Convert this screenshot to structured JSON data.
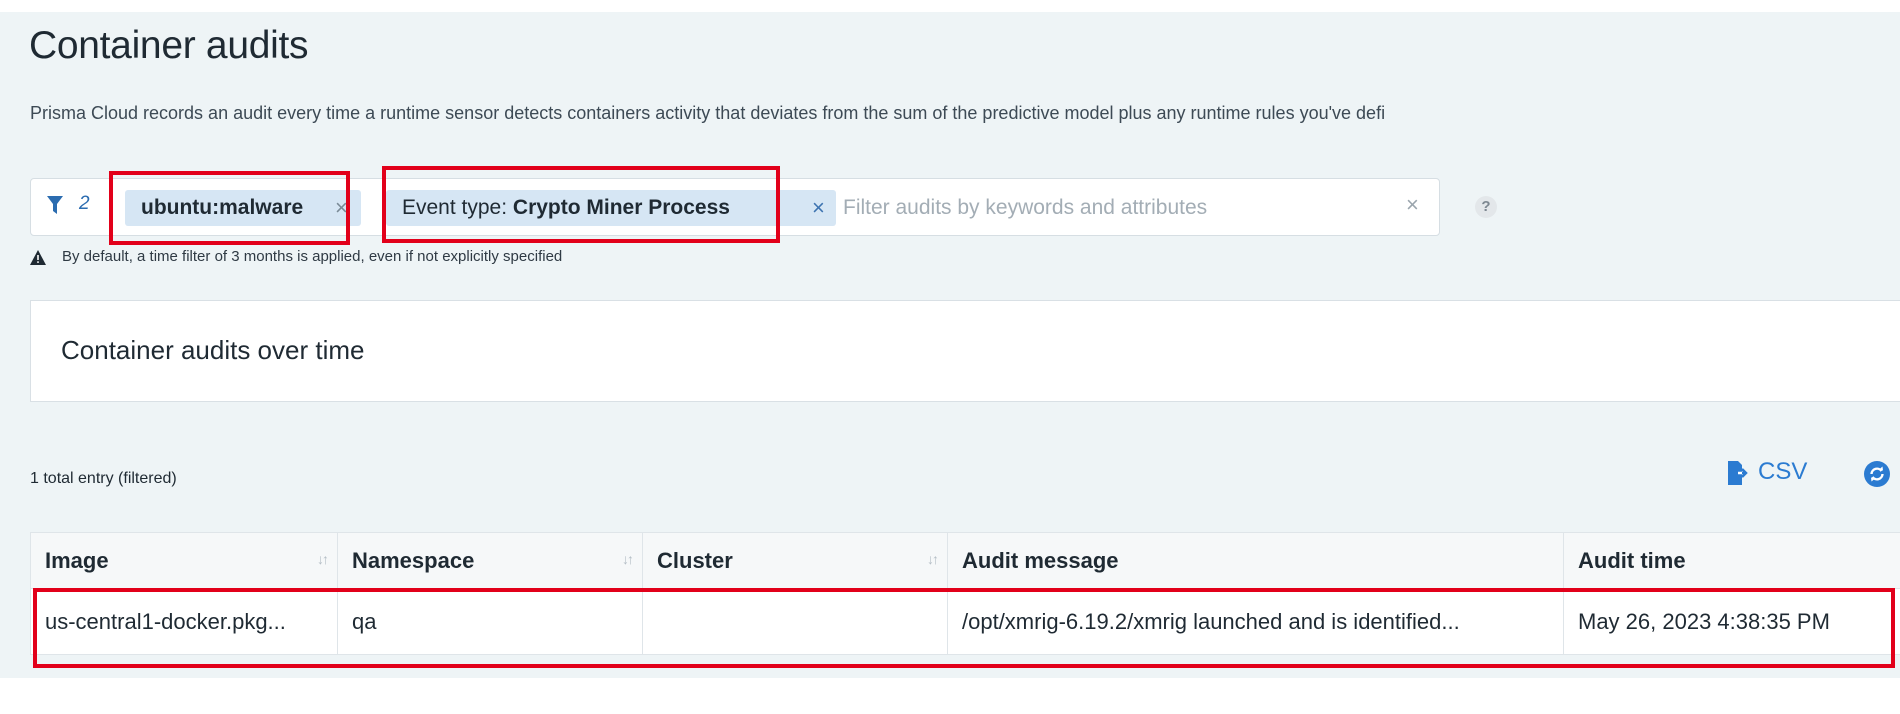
{
  "page": {
    "title": "Container audits",
    "description": "Prisma Cloud records an audit every time a runtime sensor detects containers activity that deviates from the sum of the predictive model plus any runtime rules you've defi"
  },
  "filter": {
    "count": "2",
    "chips": [
      {
        "text": "ubuntu:malware",
        "remove": "×"
      },
      {
        "prefix": "Event type: ",
        "value": "Crypto Miner Process",
        "remove": "×"
      }
    ],
    "search_placeholder": "Filter audits by keywords and attributes",
    "clear": "×",
    "help": "?",
    "note": "By default, a time filter of 3 months is applied, even if not explicitly specified"
  },
  "chart_card": {
    "title": "Container audits over time"
  },
  "table_toolbar": {
    "entry_count": "1 total entry (filtered)",
    "csv_label": "CSV"
  },
  "table": {
    "columns": [
      "Image",
      "Namespace",
      "Cluster",
      "Audit message",
      "Audit time"
    ],
    "rows": [
      [
        "us-central1-docker.pkg...",
        "qa",
        "",
        "/opt/xmrig-6.19.2/xmrig launched and is identified...",
        "May 26, 2023 4:38:35 PM"
      ]
    ]
  },
  "colors": {
    "accent": "#2b7bd1",
    "highlight": "#e2001a",
    "chip_bg": "#d6e6f4"
  },
  "icons": [
    "filter-icon",
    "warning-icon",
    "csv-export-icon",
    "refresh-icon",
    "sort-icon",
    "close-icon",
    "help-icon"
  ]
}
